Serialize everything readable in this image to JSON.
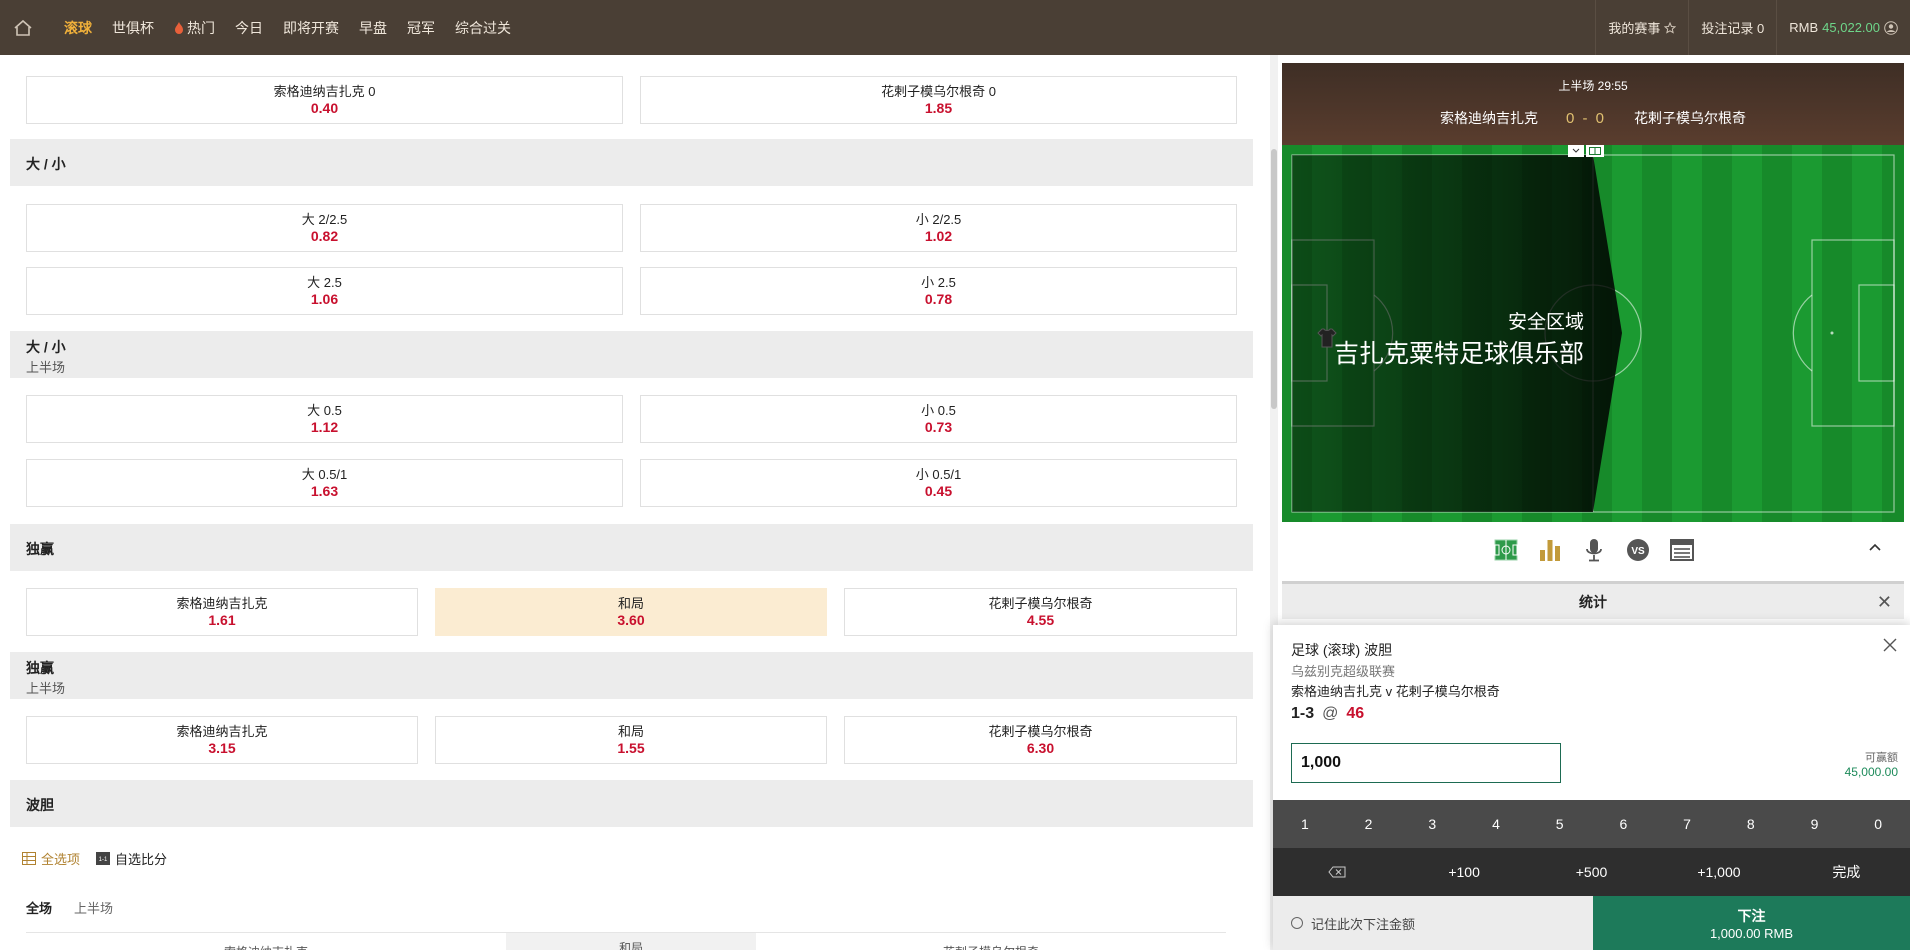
{
  "nav": {
    "items": [
      "滚球",
      "世俱杯",
      "热门",
      "今日",
      "即将开赛",
      "早盘",
      "冠军",
      "综合过关"
    ],
    "active_index": 0
  },
  "top_right": {
    "my_events": "我的赛事",
    "bet_record": "投注记录 0",
    "currency": "RMB",
    "balance": "45,022.00"
  },
  "markets": {
    "handicap_row": [
      {
        "label": "索格迪纳吉扎克 0",
        "odds": "0.40"
      },
      {
        "label": "花剌子模乌尔根奇 0",
        "odds": "1.85"
      }
    ],
    "ou_title": "大 / 小",
    "ou_rows": [
      [
        {
          "label": "大 2/2.5",
          "odds": "0.82"
        },
        {
          "label": "小 2/2.5",
          "odds": "1.02"
        }
      ],
      [
        {
          "label": "大 2.5",
          "odds": "1.06"
        },
        {
          "label": "小 2.5",
          "odds": "0.78"
        }
      ]
    ],
    "ou_half_title": "大 / 小",
    "ou_half_sub": "上半场",
    "ou_half_rows": [
      [
        {
          "label": "大 0.5",
          "odds": "1.12"
        },
        {
          "label": "小 0.5",
          "odds": "0.73"
        }
      ],
      [
        {
          "label": "大 0.5/1",
          "odds": "1.63"
        },
        {
          "label": "小 0.5/1",
          "odds": "0.45"
        }
      ]
    ],
    "win_title": "独赢",
    "win_row": [
      {
        "label": "索格迪纳吉扎克",
        "odds": "1.61"
      },
      {
        "label": "和局",
        "odds": "3.60"
      },
      {
        "label": "花剌子模乌尔根奇",
        "odds": "4.55"
      }
    ],
    "win_half_title": "独赢",
    "win_half_sub": "上半场",
    "win_half_row": [
      {
        "label": "索格迪纳吉扎克",
        "odds": "3.15"
      },
      {
        "label": "和局",
        "odds": "1.55"
      },
      {
        "label": "花剌子模乌尔根奇",
        "odds": "6.30"
      }
    ],
    "cs_title": "波胆",
    "filters": [
      "全选项",
      "自选比分"
    ],
    "periods": [
      "全场",
      "上半场"
    ],
    "bottom_cells": [
      "索格迪纳吉扎克",
      "和局",
      "花剌子模乌尔根奇"
    ]
  },
  "live": {
    "period_time": "上半场 29:55",
    "home": "索格迪纳吉扎克",
    "away": "花剌子模乌尔根奇",
    "home_score": "0",
    "away_score": "0",
    "zone_label": "安全区域",
    "zone_team": "吉扎克粟特足球俱乐部",
    "stats_label": "统计"
  },
  "slip": {
    "title": "足球 (滚球) 波胆",
    "league": "乌兹别克超级联赛",
    "match": "索格迪纳吉扎克 v 花剌子模乌尔根奇",
    "selection": "1-3",
    "at": "@",
    "odds": "46",
    "stake": "1,000",
    "available_label": "可赢额",
    "available_value": "45,000.00",
    "keys": [
      "1",
      "2",
      "3",
      "4",
      "5",
      "6",
      "7",
      "8",
      "9",
      "0"
    ],
    "quick": [
      "+100",
      "+500",
      "+1,000",
      "完成"
    ],
    "remember": "记住此次下注金额",
    "place_label": "下注",
    "place_amount": "1,000.00 RMB"
  },
  "colors": {
    "topbar": "#4a3f35",
    "active_nav": "#f0b03a",
    "odds_red": "#c8102e",
    "place_green": "#1d7a5a"
  }
}
